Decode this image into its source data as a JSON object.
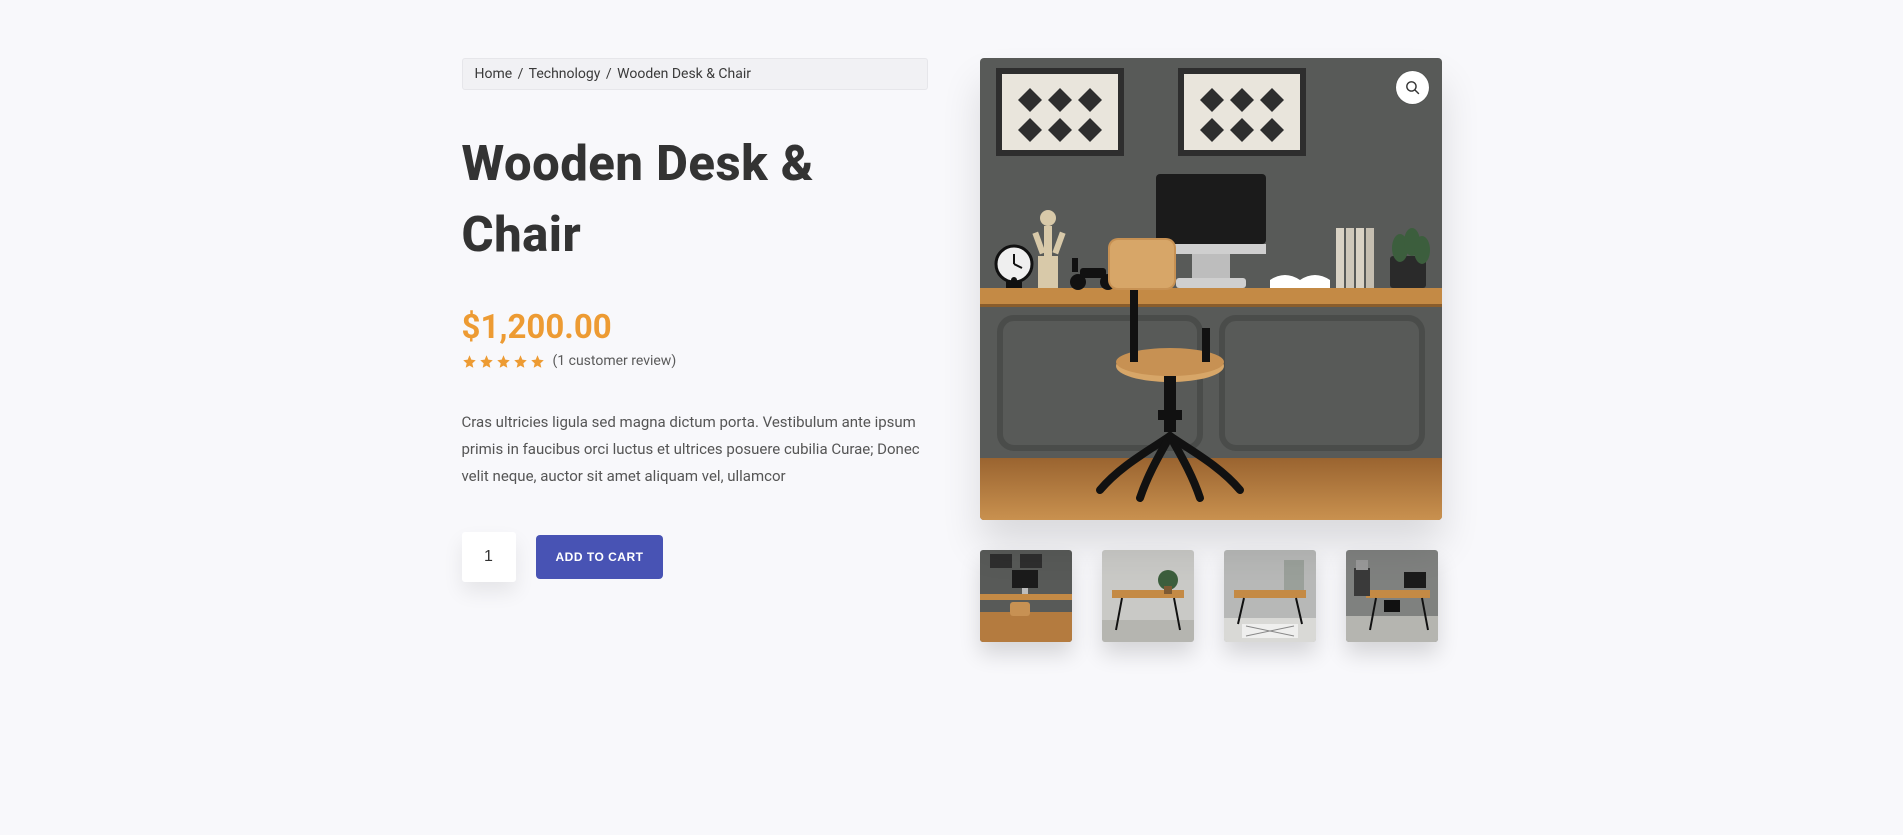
{
  "breadcrumb": {
    "home": "Home",
    "category": "Technology",
    "current": "Wooden Desk & Chair"
  },
  "product": {
    "title": "Wooden Desk & Chair",
    "currency": "$",
    "price": "1,200.00",
    "rating_stars": 5,
    "review_link": "(1 customer review)",
    "description": "Cras ultricies ligula sed magna dictum porta. Vestibulum ante ipsum primis in faucibus orci luctus et ultrices posuere cubilia Curae; Donec velit neque, auctor sit amet aliquam vel, ullamcor",
    "quantity": "1",
    "add_to_cart_label": "ADD TO CART"
  },
  "gallery": {
    "zoom_icon": "search-icon",
    "thumbnail_count": 4
  },
  "colors": {
    "accent": "#ed9b33",
    "primary_button": "#4853b4"
  }
}
